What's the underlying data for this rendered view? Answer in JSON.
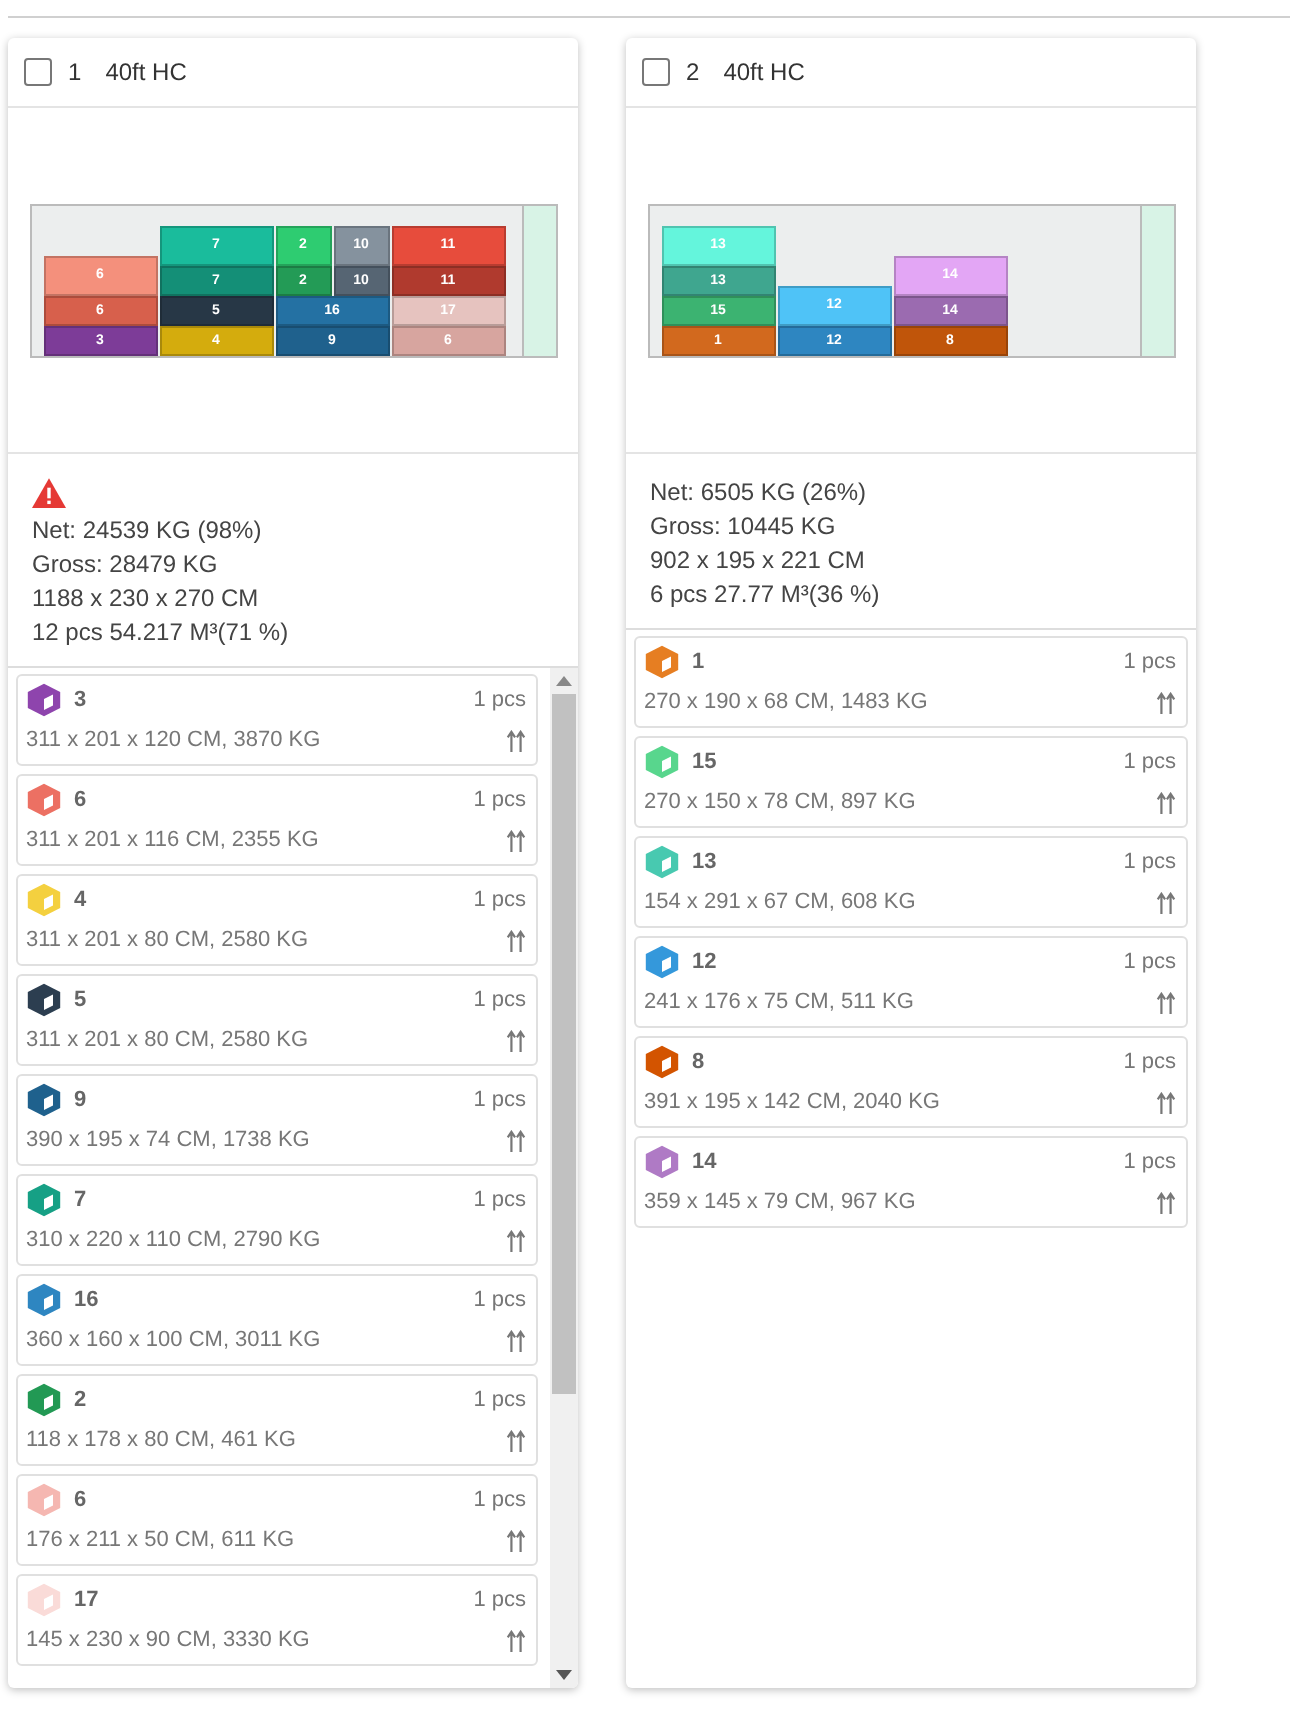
{
  "containers": [
    {
      "index": "1",
      "type": "40ft HC",
      "checked": false,
      "warning": true,
      "stacks": [
        [
          [
            {
              "label": "6",
              "color": "#f4907c"
            }
          ],
          [
            {
              "label": "6",
              "color": "#d7604c"
            }
          ],
          [
            {
              "label": "3",
              "color": "#7d3c98"
            }
          ]
        ],
        [
          [
            {
              "label": "7",
              "color": "#1abc9c"
            }
          ],
          [
            {
              "label": "7",
              "color": "#148f77"
            }
          ],
          [
            {
              "label": "5",
              "color": "#273746"
            }
          ],
          [
            {
              "label": "4",
              "color": "#d4ac0d"
            }
          ]
        ],
        [
          [
            {
              "label": "2",
              "color": "#2ecc71"
            },
            {
              "label": "10",
              "color": "#85929e"
            }
          ],
          [
            {
              "label": "2",
              "color": "#239b56"
            },
            {
              "label": "10",
              "color": "#566573"
            }
          ],
          [
            {
              "label": "16",
              "color": "#2471a3"
            }
          ],
          [
            {
              "label": "9",
              "color": "#1f618d"
            }
          ]
        ],
        [
          [
            {
              "label": "11",
              "color": "#e74c3c"
            }
          ],
          [
            {
              "label": "11",
              "color": "#b03a2e"
            }
          ],
          [
            {
              "label": "17",
              "color": "#e6c3bf"
            }
          ],
          [
            {
              "label": "6",
              "color": "#d7a59f"
            }
          ]
        ]
      ],
      "stats": [
        "Net: 24539 KG (98%)",
        "Gross: 28479 KG",
        "1188 x 230 x 270 CM",
        "12 pcs  54.217 M³(71 %)"
      ],
      "scrollable": true,
      "items": [
        {
          "name": "3",
          "dims": "311 x 201 x 120 CM, 3870 KG",
          "qty": "1 pcs",
          "color": "#8e44ad"
        },
        {
          "name": "6",
          "dims": "311 x 201 x 116 CM, 2355 KG",
          "qty": "1 pcs",
          "color": "#ec7063"
        },
        {
          "name": "4",
          "dims": "311 x 201 x 80 CM, 2580 KG",
          "qty": "1 pcs",
          "color": "#f4d03f"
        },
        {
          "name": "5",
          "dims": "311 x 201 x 80 CM, 2580 KG",
          "qty": "1 pcs",
          "color": "#2c3e50"
        },
        {
          "name": "9",
          "dims": "390 x 195 x 74 CM, 1738 KG",
          "qty": "1 pcs",
          "color": "#1f618d"
        },
        {
          "name": "7",
          "dims": "310 x 220 x 110 CM, 2790 KG",
          "qty": "1 pcs",
          "color": "#16a085"
        },
        {
          "name": "16",
          "dims": "360 x 160 x 100 CM, 3011 KG",
          "qty": "1 pcs",
          "color": "#2e86c1"
        },
        {
          "name": "2",
          "dims": "118 x 178 x 80 CM, 461 KG",
          "qty": "1 pcs",
          "color": "#229954"
        },
        {
          "name": "6",
          "dims": "176 x 211 x 50 CM, 611 KG",
          "qty": "1 pcs",
          "color": "#f5b7b1"
        },
        {
          "name": "17",
          "dims": "145 x 230 x 90 CM, 3330 KG",
          "qty": "1 pcs",
          "color": "#fadbd8"
        }
      ]
    },
    {
      "index": "2",
      "type": "40ft HC",
      "checked": false,
      "warning": false,
      "stacks": [
        [
          [
            {
              "label": "13",
              "color": "#64f5dc"
            }
          ],
          [
            {
              "label": "13",
              "color": "#3fa68f"
            }
          ],
          [
            {
              "label": "15",
              "color": "#3cb371"
            }
          ],
          [
            {
              "label": "1",
              "color": "#d2691e"
            }
          ]
        ],
        [
          [
            {
              "label": "12",
              "color": "#4fc3f7"
            }
          ],
          [
            {
              "label": "12",
              "color": "#2e86c1"
            }
          ]
        ],
        [
          [
            {
              "label": "14",
              "color": "#e3a6f5"
            }
          ],
          [
            {
              "label": "14",
              "color": "#9b6bb0"
            }
          ],
          [
            {
              "label": "8",
              "color": "#c0550a"
            }
          ]
        ]
      ],
      "stats": [
        "Net: 6505 KG (26%)",
        "Gross: 10445 KG",
        "902 x 195 x 221 CM",
        "6 pcs  27.77 M³(36 %)"
      ],
      "scrollable": false,
      "items": [
        {
          "name": "1",
          "dims": "270 x 190 x 68 CM, 1483 KG",
          "qty": "1 pcs",
          "color": "#e67e22"
        },
        {
          "name": "15",
          "dims": "270 x 150 x 78 CM, 897 KG",
          "qty": "1 pcs",
          "color": "#58d68d"
        },
        {
          "name": "13",
          "dims": "154 x 291 x 67 CM, 608 KG",
          "qty": "1 pcs",
          "color": "#48c9b0"
        },
        {
          "name": "12",
          "dims": "241 x 176 x 75 CM, 511 KG",
          "qty": "1 pcs",
          "color": "#3498db"
        },
        {
          "name": "8",
          "dims": "391 x 195 x 142 CM, 2040 KG",
          "qty": "1 pcs",
          "color": "#d35400"
        },
        {
          "name": "14",
          "dims": "359 x 145 x 79 CM, 967 KG",
          "qty": "1 pcs",
          "color": "#af7ac5"
        }
      ]
    }
  ]
}
